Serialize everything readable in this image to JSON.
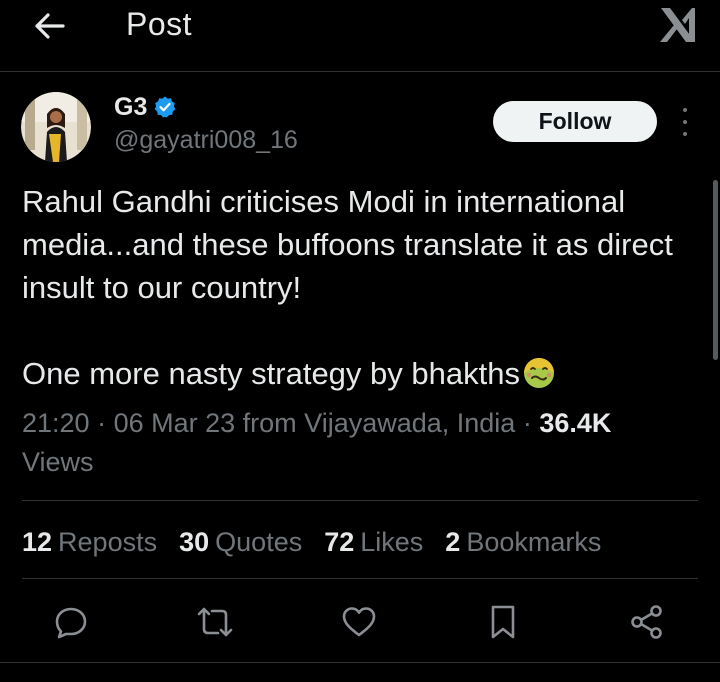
{
  "header": {
    "title": "Post",
    "back_icon": "arrow-left-icon",
    "logo_icon": "x-logo-icon"
  },
  "author": {
    "name": "G3",
    "handle": "@gayatri008_16",
    "verified": true,
    "verified_color": "#1d9bf0"
  },
  "follow_label": "Follow",
  "tweet": {
    "paragraph_1": "Rahul Gandhi criticises Modi in international media...and these buffoons translate it as direct insult to our country!",
    "paragraph_2": "One more nasty strategy by bhakths",
    "emoji": "nauseated-face-emoji"
  },
  "meta": {
    "time": "21:20",
    "separator": " · ",
    "date": "06 Mar 23",
    "location": "from Vijayawada, India",
    "views_count": "36.4K",
    "views_label": "Views"
  },
  "stats": [
    {
      "count": "12",
      "label": "Reposts"
    },
    {
      "count": "30",
      "label": "Quotes"
    },
    {
      "count": "72",
      "label": "Likes"
    },
    {
      "count": "2",
      "label": "Bookmarks"
    }
  ],
  "actions": [
    {
      "icon": "reply-icon"
    },
    {
      "icon": "repost-icon"
    },
    {
      "icon": "like-icon"
    },
    {
      "icon": "bookmark-icon"
    },
    {
      "icon": "share-icon"
    }
  ],
  "colors": {
    "background": "#000000",
    "text_primary": "#e7e9ea",
    "text_secondary": "#71767b",
    "divider": "#2f3336",
    "follow_bg": "#eff3f4"
  }
}
